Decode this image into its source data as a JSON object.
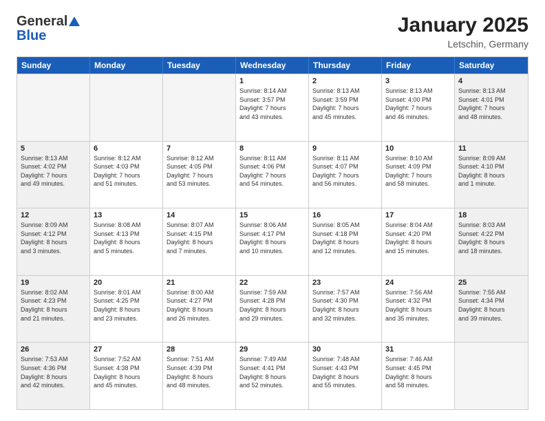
{
  "header": {
    "logo_general": "General",
    "logo_blue": "Blue",
    "month_year": "January 2025",
    "location": "Letschin, Germany"
  },
  "days_of_week": [
    "Sunday",
    "Monday",
    "Tuesday",
    "Wednesday",
    "Thursday",
    "Friday",
    "Saturday"
  ],
  "weeks": [
    [
      {
        "day": "",
        "info": "",
        "empty": true
      },
      {
        "day": "",
        "info": "",
        "empty": true
      },
      {
        "day": "",
        "info": "",
        "empty": true
      },
      {
        "day": "1",
        "info": "Sunrise: 8:14 AM\nSunset: 3:57 PM\nDaylight: 7 hours\nand 43 minutes.",
        "empty": false
      },
      {
        "day": "2",
        "info": "Sunrise: 8:13 AM\nSunset: 3:59 PM\nDaylight: 7 hours\nand 45 minutes.",
        "empty": false
      },
      {
        "day": "3",
        "info": "Sunrise: 8:13 AM\nSunset: 4:00 PM\nDaylight: 7 hours\nand 46 minutes.",
        "empty": false
      },
      {
        "day": "4",
        "info": "Sunrise: 8:13 AM\nSunset: 4:01 PM\nDaylight: 7 hours\nand 48 minutes.",
        "empty": false
      }
    ],
    [
      {
        "day": "5",
        "info": "Sunrise: 8:13 AM\nSunset: 4:02 PM\nDaylight: 7 hours\nand 49 minutes.",
        "empty": false
      },
      {
        "day": "6",
        "info": "Sunrise: 8:12 AM\nSunset: 4:03 PM\nDaylight: 7 hours\nand 51 minutes.",
        "empty": false
      },
      {
        "day": "7",
        "info": "Sunrise: 8:12 AM\nSunset: 4:05 PM\nDaylight: 7 hours\nand 53 minutes.",
        "empty": false
      },
      {
        "day": "8",
        "info": "Sunrise: 8:11 AM\nSunset: 4:06 PM\nDaylight: 7 hours\nand 54 minutes.",
        "empty": false
      },
      {
        "day": "9",
        "info": "Sunrise: 8:11 AM\nSunset: 4:07 PM\nDaylight: 7 hours\nand 56 minutes.",
        "empty": false
      },
      {
        "day": "10",
        "info": "Sunrise: 8:10 AM\nSunset: 4:09 PM\nDaylight: 7 hours\nand 58 minutes.",
        "empty": false
      },
      {
        "day": "11",
        "info": "Sunrise: 8:09 AM\nSunset: 4:10 PM\nDaylight: 8 hours\nand 1 minute.",
        "empty": false
      }
    ],
    [
      {
        "day": "12",
        "info": "Sunrise: 8:09 AM\nSunset: 4:12 PM\nDaylight: 8 hours\nand 3 minutes.",
        "empty": false
      },
      {
        "day": "13",
        "info": "Sunrise: 8:08 AM\nSunset: 4:13 PM\nDaylight: 8 hours\nand 5 minutes.",
        "empty": false
      },
      {
        "day": "14",
        "info": "Sunrise: 8:07 AM\nSunset: 4:15 PM\nDaylight: 8 hours\nand 7 minutes.",
        "empty": false
      },
      {
        "day": "15",
        "info": "Sunrise: 8:06 AM\nSunset: 4:17 PM\nDaylight: 8 hours\nand 10 minutes.",
        "empty": false
      },
      {
        "day": "16",
        "info": "Sunrise: 8:05 AM\nSunset: 4:18 PM\nDaylight: 8 hours\nand 12 minutes.",
        "empty": false
      },
      {
        "day": "17",
        "info": "Sunrise: 8:04 AM\nSunset: 4:20 PM\nDaylight: 8 hours\nand 15 minutes.",
        "empty": false
      },
      {
        "day": "18",
        "info": "Sunrise: 8:03 AM\nSunset: 4:22 PM\nDaylight: 8 hours\nand 18 minutes.",
        "empty": false
      }
    ],
    [
      {
        "day": "19",
        "info": "Sunrise: 8:02 AM\nSunset: 4:23 PM\nDaylight: 8 hours\nand 21 minutes.",
        "empty": false
      },
      {
        "day": "20",
        "info": "Sunrise: 8:01 AM\nSunset: 4:25 PM\nDaylight: 8 hours\nand 23 minutes.",
        "empty": false
      },
      {
        "day": "21",
        "info": "Sunrise: 8:00 AM\nSunset: 4:27 PM\nDaylight: 8 hours\nand 26 minutes.",
        "empty": false
      },
      {
        "day": "22",
        "info": "Sunrise: 7:59 AM\nSunset: 4:28 PM\nDaylight: 8 hours\nand 29 minutes.",
        "empty": false
      },
      {
        "day": "23",
        "info": "Sunrise: 7:57 AM\nSunset: 4:30 PM\nDaylight: 8 hours\nand 32 minutes.",
        "empty": false
      },
      {
        "day": "24",
        "info": "Sunrise: 7:56 AM\nSunset: 4:32 PM\nDaylight: 8 hours\nand 35 minutes.",
        "empty": false
      },
      {
        "day": "25",
        "info": "Sunrise: 7:55 AM\nSunset: 4:34 PM\nDaylight: 8 hours\nand 39 minutes.",
        "empty": false
      }
    ],
    [
      {
        "day": "26",
        "info": "Sunrise: 7:53 AM\nSunset: 4:36 PM\nDaylight: 8 hours\nand 42 minutes.",
        "empty": false
      },
      {
        "day": "27",
        "info": "Sunrise: 7:52 AM\nSunset: 4:38 PM\nDaylight: 8 hours\nand 45 minutes.",
        "empty": false
      },
      {
        "day": "28",
        "info": "Sunrise: 7:51 AM\nSunset: 4:39 PM\nDaylight: 8 hours\nand 48 minutes.",
        "empty": false
      },
      {
        "day": "29",
        "info": "Sunrise: 7:49 AM\nSunset: 4:41 PM\nDaylight: 8 hours\nand 52 minutes.",
        "empty": false
      },
      {
        "day": "30",
        "info": "Sunrise: 7:48 AM\nSunset: 4:43 PM\nDaylight: 8 hours\nand 55 minutes.",
        "empty": false
      },
      {
        "day": "31",
        "info": "Sunrise: 7:46 AM\nSunset: 4:45 PM\nDaylight: 8 hours\nand 58 minutes.",
        "empty": false
      },
      {
        "day": "",
        "info": "",
        "empty": true
      }
    ]
  ]
}
